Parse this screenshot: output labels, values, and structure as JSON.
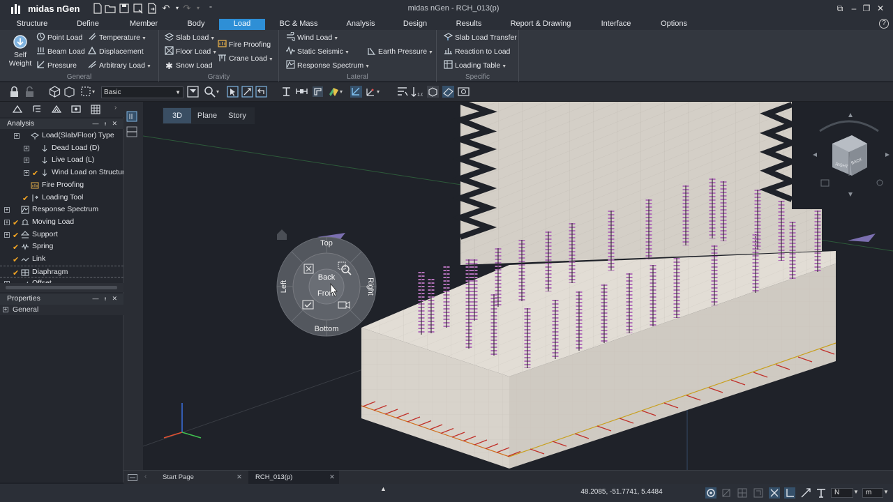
{
  "app": {
    "name": "midas nGen",
    "document_title": "midas nGen - RCH_013(p)"
  },
  "menubar": {
    "items": [
      "Structure",
      "Define",
      "Member",
      "Body",
      "Load",
      "BC & Mass",
      "Analysis",
      "Design",
      "Results",
      "Report & Drawing",
      "Interface",
      "Options"
    ],
    "active": "Load"
  },
  "ribbon": {
    "general": {
      "label": "General",
      "self_weight": "Self\nWeight",
      "self_weight_l1": "Self",
      "self_weight_l2": "Weight",
      "point_load": "Point Load",
      "beam_load": "Beam Load",
      "pressure": "Pressure",
      "temperature": "Temperature",
      "displacement": "Displacement",
      "arbitrary_load": "Arbitrary Load"
    },
    "gravity": {
      "label": "Gravity",
      "slab_load": "Slab Load",
      "floor_load": "Floor Load",
      "snow_load": "Snow Load",
      "fire_proofing": "Fire Proofing",
      "crane_load": "Crane Load"
    },
    "lateral": {
      "label": "Lateral",
      "wind_load": "Wind Load",
      "static_seismic": "Static Seismic",
      "response_spectrum": "Response Spectrum",
      "earth_pressure": "Earth Pressure"
    },
    "specific": {
      "label": "Specific",
      "slab_load_transfer": "Slab Load Transfer",
      "reaction_to_load": "Reaction to Load",
      "loading_table": "Loading Table"
    }
  },
  "toolbar": {
    "view_combo": "Basic"
  },
  "analysis_panel": {
    "title": "Analysis",
    "items": [
      {
        "label": "Load(Slab/Floor) Type",
        "indent": 1,
        "expander": "+",
        "checked": false
      },
      {
        "label": "Dead Load (D)",
        "indent": 2,
        "expander": "+",
        "checked": false
      },
      {
        "label": "Live Load (L)",
        "indent": 2,
        "expander": "+",
        "checked": false
      },
      {
        "label": "Wind Load on Structure (",
        "indent": 2,
        "expander": "+",
        "checked": true
      },
      {
        "label": "Fire Proofing",
        "indent": 1,
        "expander": "",
        "checked": false
      },
      {
        "label": "Loading Tool",
        "indent": 1,
        "expander": "",
        "checked": true
      },
      {
        "label": "Response Spectrum",
        "indent": 0,
        "expander": "+",
        "checked": false
      },
      {
        "label": "Moving Load",
        "indent": 0,
        "expander": "+",
        "checked": true
      },
      {
        "label": "Support",
        "indent": 0,
        "expander": "+",
        "checked": true
      },
      {
        "label": "Spring",
        "indent": 0,
        "expander": "",
        "checked": true
      },
      {
        "label": "Link",
        "indent": 0,
        "expander": "",
        "checked": true
      },
      {
        "label": "Diaphragm",
        "indent": 0,
        "expander": "",
        "checked": true
      },
      {
        "label": "Offset",
        "indent": 0,
        "expander": "+",
        "checked": false
      }
    ]
  },
  "properties_panel": {
    "title": "Properties",
    "section": "General"
  },
  "view_tabs": {
    "items": [
      "3D",
      "Plane",
      "Story"
    ],
    "active": "3D"
  },
  "view_wheel": {
    "top": "Top",
    "bottom": "Bottom",
    "left": "Left",
    "right": "Right",
    "back": "Back",
    "front": "Front"
  },
  "view_cube": {
    "face1": "RIGHT",
    "face2": "BACK"
  },
  "document_tabs": {
    "items": [
      "Start Page",
      "RCH_013(p)"
    ],
    "active": "RCH_013(p)"
  },
  "status": {
    "coordinates": "48.2085, -51.7741, 5.4484",
    "force_unit": "N",
    "length_unit": "m"
  },
  "colors": {
    "accent": "#2e8fd6",
    "background": "#1f2229",
    "check": "#f5a623",
    "slab": "#d8d3cb",
    "load_arrow": "#b070b8"
  }
}
